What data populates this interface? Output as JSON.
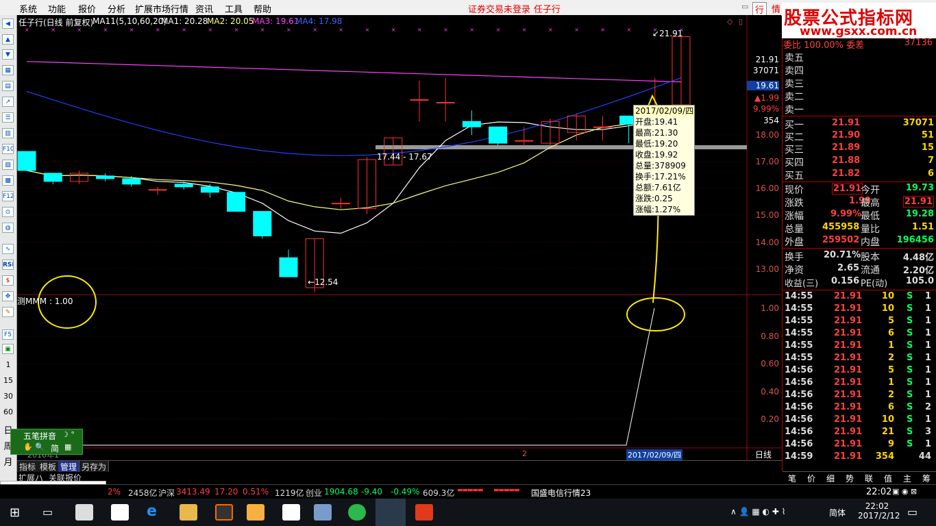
{
  "menu": {
    "items": [
      "系统",
      "功能",
      "报价",
      "分析",
      "扩展市场行情",
      "资讯",
      "工具",
      "帮助"
    ],
    "status_warning": "证券交易未登录",
    "stock_name_short": "任子行",
    "right_btn": "行",
    "right_btn2": "情"
  },
  "watermark": {
    "title": "股票公式指标网",
    "url": "www.gsxx.com.cn"
  },
  "chart": {
    "header": {
      "title": "任子行(日线 前复权)",
      "ma_label": "MA11(5,10,60,20)",
      "ma1": "MA1: 20.28",
      "ma2": "MA2: 20.05",
      "ma3": "MA3: 19.61",
      "ma4": "MA4: 17.98"
    },
    "price_high_label": "21.91",
    "price_low_label": "12.54",
    "range_label": "17.44 - 17.67",
    "axis_price": [
      "21.91",
      "37071",
      "19.61",
      "▲1.99",
      "9.99%",
      "354",
      "18.00",
      "17.00",
      "16.00",
      "15.00",
      "14.00",
      "13.00"
    ],
    "axis_ind": [
      "1.00",
      "0.80",
      "0.60",
      "0.40",
      "0.20"
    ],
    "indicator_label": "测MMM : 1.00",
    "date_axis": [
      "2016年1",
      "2",
      "2017/02/09/四"
    ],
    "period_label": "日线",
    "scale_btns": [
      "+",
      "-",
      "0"
    ],
    "popup": {
      "date": "2017/02/09/四",
      "rows": [
        "开盘:19.41",
        "最高:21.30",
        "最低:19.20",
        "收盘:19.92",
        "总量:378909",
        "换手:17.21%",
        "总额:7.61亿",
        "涨跌:0.25",
        "涨幅:1.27%"
      ]
    },
    "colors": {
      "up": "#ff3030",
      "down": "#00ffff",
      "ma_white": "#ffffff",
      "ma_yellow": "#ffff80",
      "ma_magenta": "#ff40ff",
      "ma_blue": "#2040ff",
      "annot": "#ffee00"
    }
  },
  "chart_data": {
    "type": "candlestick",
    "candles": [
      {
        "o": 17.7,
        "c": 17.0,
        "h": 17.7,
        "l": 17.0
      },
      {
        "o": 16.9,
        "c": 16.6,
        "h": 16.9,
        "l": 16.5
      },
      {
        "o": 16.6,
        "c": 16.9,
        "h": 17.0,
        "l": 16.5
      },
      {
        "o": 16.8,
        "c": 16.7,
        "h": 16.9,
        "l": 16.6
      },
      {
        "o": 16.7,
        "c": 16.5,
        "h": 16.8,
        "l": 16.4
      },
      {
        "o": 16.3,
        "c": 16.3,
        "h": 16.4,
        "l": 16.1
      },
      {
        "o": 16.5,
        "c": 16.4,
        "h": 16.6,
        "l": 16.3
      },
      {
        "o": 16.4,
        "c": 16.2,
        "h": 16.5,
        "l": 16.0
      },
      {
        "o": 16.2,
        "c": 15.5,
        "h": 16.2,
        "l": 15.5
      },
      {
        "o": 15.5,
        "c": 14.6,
        "h": 15.5,
        "l": 14.5
      },
      {
        "o": 13.8,
        "c": 13.1,
        "h": 14.1,
        "l": 13.1
      },
      {
        "o": 12.7,
        "c": 14.5,
        "h": 14.5,
        "l": 12.54
      },
      {
        "o": 15.8,
        "c": 15.8,
        "h": 16.0,
        "l": 15.6
      },
      {
        "o": 15.6,
        "c": 17.4,
        "h": 17.5,
        "l": 15.4
      },
      {
        "o": 17.2,
        "c": 18.2,
        "h": 18.2,
        "l": 17.2
      },
      {
        "o": 19.6,
        "c": 19.6,
        "h": 20.3,
        "l": 18.8
      },
      {
        "o": 19.5,
        "c": 19.5,
        "h": 20.4,
        "l": 18.8
      },
      {
        "o": 18.8,
        "c": 18.6,
        "h": 19.2,
        "l": 18.3
      },
      {
        "o": 18.6,
        "c": 18.0,
        "h": 18.6,
        "l": 17.9
      },
      {
        "o": 18.1,
        "c": 18.1,
        "h": 18.6,
        "l": 17.9
      },
      {
        "o": 18.0,
        "c": 18.8,
        "h": 18.9,
        "l": 17.9
      },
      {
        "o": 18.4,
        "c": 19.0,
        "h": 19.1,
        "l": 18.1
      },
      {
        "o": 18.6,
        "c": 18.6,
        "h": 19.0,
        "l": 18.1
      },
      {
        "o": 19.0,
        "c": 18.7,
        "h": 19.0,
        "l": 18.0
      },
      {
        "o": 18.4,
        "c": 18.8,
        "h": 20.4,
        "l": 18.3
      },
      {
        "o": 19.41,
        "c": 21.91,
        "h": 21.91,
        "l": 19.2
      }
    ],
    "ylim": [
      12.5,
      22.2
    ]
  },
  "orderbook": {
    "top": {
      "label1": "委比",
      "val1": "100.00%",
      "label2": "委差",
      "val2": "37136"
    },
    "sell": [
      {
        "label": "卖五",
        "price": "",
        "vol": ""
      },
      {
        "label": "卖四",
        "price": "",
        "vol": ""
      },
      {
        "label": "卖三",
        "price": "",
        "vol": ""
      },
      {
        "label": "卖二",
        "price": "",
        "vol": ""
      },
      {
        "label": "卖一",
        "price": "",
        "vol": ""
      }
    ],
    "buy": [
      {
        "label": "买一",
        "price": "21.91",
        "vol": "37071"
      },
      {
        "label": "买二",
        "price": "21.90",
        "vol": "51"
      },
      {
        "label": "买三",
        "price": "21.89",
        "vol": "15"
      },
      {
        "label": "买四",
        "price": "21.88",
        "vol": "7"
      },
      {
        "label": "买五",
        "price": "21.82",
        "vol": "6"
      }
    ]
  },
  "quote": [
    {
      "l1": "现价",
      "v1": "21.91",
      "l2": "今开",
      "v2": "19.73"
    },
    {
      "l1": "涨跌",
      "v1": "1.99",
      "l2": "最高",
      "v2": "21.91"
    },
    {
      "l1": "涨幅",
      "v1": "9.99%",
      "l2": "最低",
      "v2": "19.28"
    },
    {
      "l1": "总量",
      "v1": "455958",
      "l2": "量比",
      "v2": "1.51"
    },
    {
      "l1": "外盘",
      "v1": "259502",
      "l2": "内盘",
      "v2": "196456"
    },
    {
      "l1": "换手",
      "v1": "20.71%",
      "l2": "股本",
      "v2": "4.48亿"
    },
    {
      "l1": "净资",
      "v1": "2.65",
      "l2": "流通",
      "v2": "2.20亿"
    },
    {
      "l1": "收益(三)",
      "v1": "0.156",
      "l2": "PE(动)",
      "v2": "105.0"
    }
  ],
  "ticks": [
    {
      "t": "14:55",
      "p": "21.91",
      "v": "10",
      "s": "S",
      "n": "1"
    },
    {
      "t": "14:55",
      "p": "21.91",
      "v": "10",
      "s": "S",
      "n": "1"
    },
    {
      "t": "14:55",
      "p": "21.91",
      "v": "5",
      "s": "S",
      "n": "1"
    },
    {
      "t": "14:55",
      "p": "21.91",
      "v": "6",
      "s": "S",
      "n": "1"
    },
    {
      "t": "14:55",
      "p": "21.91",
      "v": "1",
      "s": "S",
      "n": "1"
    },
    {
      "t": "14:55",
      "p": "21.91",
      "v": "2",
      "s": "S",
      "n": "1"
    },
    {
      "t": "14:56",
      "p": "21.91",
      "v": "5",
      "s": "S",
      "n": "1"
    },
    {
      "t": "14:56",
      "p": "21.91",
      "v": "1",
      "s": "S",
      "n": "1"
    },
    {
      "t": "14:56",
      "p": "21.91",
      "v": "2",
      "s": "S",
      "n": "1"
    },
    {
      "t": "14:56",
      "p": "21.91",
      "v": "6",
      "s": "S",
      "n": "2"
    },
    {
      "t": "14:56",
      "p": "21.91",
      "v": "10",
      "s": "S",
      "n": "1"
    },
    {
      "t": "14:56",
      "p": "21.91",
      "v": "21",
      "s": "S",
      "n": "3"
    },
    {
      "t": "14:56",
      "p": "21.91",
      "v": "9",
      "s": "S",
      "n": "1"
    },
    {
      "t": "14:59",
      "p": "21.91",
      "v": "354",
      "s": "",
      "n": "44"
    }
  ],
  "right_tabs": [
    "笔",
    "价",
    "细",
    "势",
    "联",
    "值",
    "主",
    "筹"
  ],
  "tabs": [
    "指标",
    "模板",
    "管理",
    "另存为"
  ],
  "subtabs": [
    "扩展ハ",
    "关联报价"
  ],
  "ime": {
    "name": "五笔拼音",
    "mode": "简"
  },
  "status": {
    "s1": "2%",
    "s2": "2458亿",
    "hs_label": "沪深",
    "hs_val": "3413.49",
    "hs_chg": "17.20",
    "hs_pct": "0.51%",
    "hs_amt": "1219亿",
    "cy_label": "创业",
    "cy_val": "1904.68",
    "cy_chg": "-9.40",
    "cy_pct": "-0.49%",
    "cy_amt": "609.3亿",
    "ticker": "国盛电信行情23"
  },
  "left_numbers": [
    "1",
    "15",
    "30",
    "60",
    "日",
    "周",
    "月"
  ],
  "taskbar": {
    "lang": "简体",
    "time": "22:02",
    "date": "2017/2/12"
  }
}
